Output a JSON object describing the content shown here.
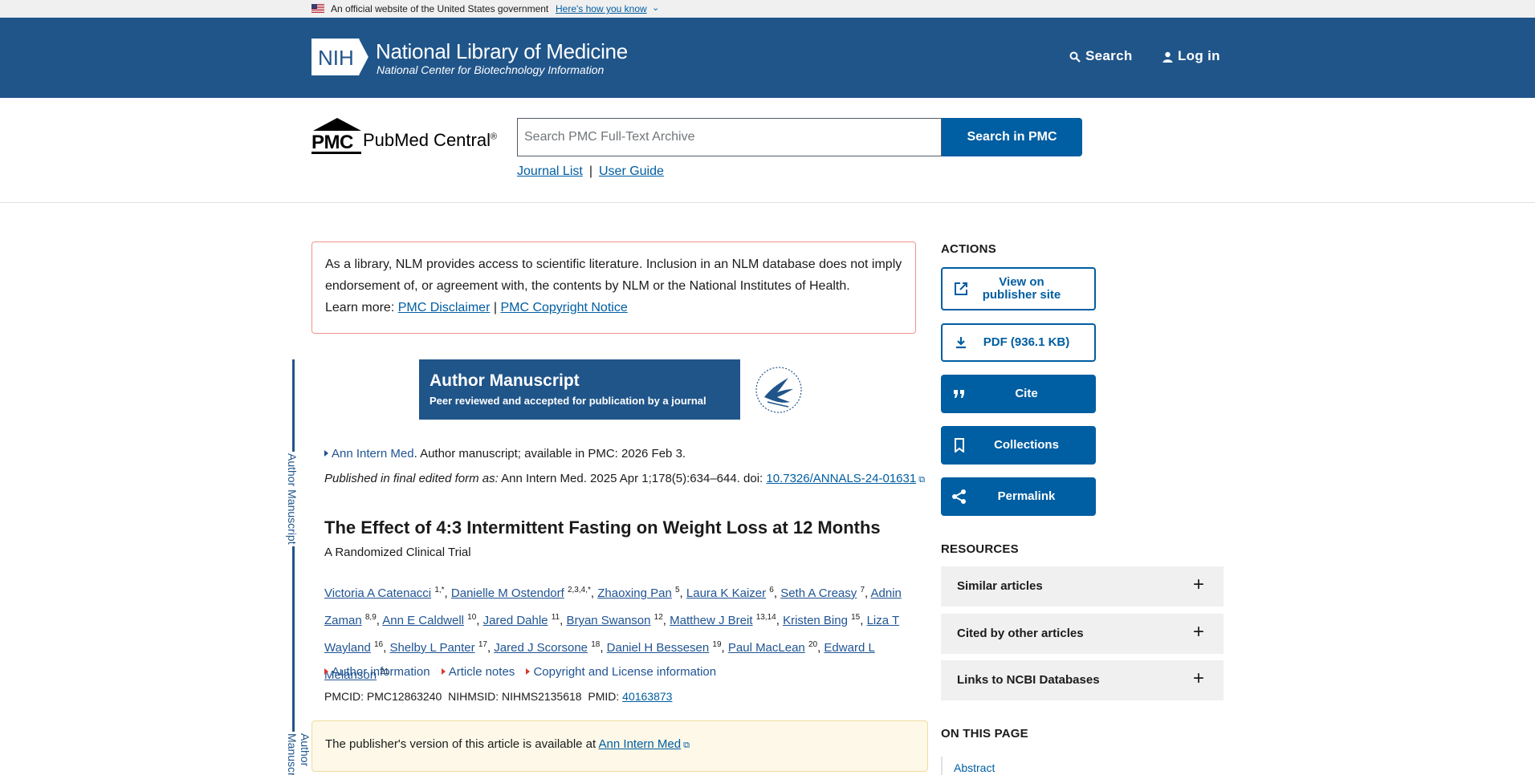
{
  "gov_banner": {
    "official_text": "An official website of the United States government",
    "how_know_link": "Here's how you know"
  },
  "nlm_header": {
    "logo_text": "NIH",
    "title": "National Library of Medicine",
    "subtitle": "National Center for Biotechnology Information",
    "search_label": "Search",
    "login_label": "Log in"
  },
  "pmc": {
    "logo_text": "PMC",
    "name": "PubMed Central",
    "name_mark": "®",
    "search_placeholder": "Search PMC Full-Text Archive",
    "search_button": "Search in PMC",
    "journal_list": "Journal List",
    "user_guide": "User Guide",
    "separator": "|"
  },
  "disclaimer": {
    "text": "As a library, NLM provides access to scientific literature. Inclusion in an NLM database does not imply endorsement of, or agreement with, the contents by NLM or the National Institutes of Health.",
    "learn_more": "Learn more:",
    "link1": "PMC Disclaimer",
    "sep": "|",
    "link2": "PMC Copyright Notice"
  },
  "side_label": "Author Manuscript",
  "manuscript_banner": {
    "title": "Author Manuscript",
    "subtitle": "Peer reviewed and accepted for publication by a journal"
  },
  "article": {
    "journal_link": "Ann Intern Med",
    "journal_rest": ". Author manuscript; available in PMC: 2026 Feb 3.",
    "published_prefix": "Published in final edited form as:",
    "published_citation": "Ann Intern Med. 2025 Apr 1;178(5):634–644. doi:",
    "doi": "10.7326/ANNALS-24-01631",
    "title": "The Effect of 4:3 Intermittent Fasting on Weight Loss at 12 Months",
    "subtitle": "A Randomized Clinical Trial",
    "authors": [
      {
        "name": "Victoria A Catenacci",
        "sup": "1,*"
      },
      {
        "name": "Danielle M Ostendorf",
        "sup": "2,3,4,*"
      },
      {
        "name": "Zhaoxing Pan",
        "sup": "5"
      },
      {
        "name": "Laura K Kaizer",
        "sup": "6"
      },
      {
        "name": "Seth A Creasy",
        "sup": "7"
      },
      {
        "name": "Adnin Zaman",
        "sup": "8,9"
      },
      {
        "name": "Ann E Caldwell",
        "sup": "10"
      },
      {
        "name": "Jared Dahle",
        "sup": "11"
      },
      {
        "name": "Bryan Swanson",
        "sup": "12"
      },
      {
        "name": "Matthew J Breit",
        "sup": "13,14"
      },
      {
        "name": "Kristen Bing",
        "sup": "15"
      },
      {
        "name": "Liza T Wayland",
        "sup": "16"
      },
      {
        "name": "Shelby L Panter",
        "sup": "17"
      },
      {
        "name": "Jared J Scorsone",
        "sup": "18"
      },
      {
        "name": "Daniel H Bessesen",
        "sup": "19"
      },
      {
        "name": "Paul MacLean",
        "sup": "20"
      },
      {
        "name": "Edward L Melanson",
        "sup": "21"
      }
    ],
    "info_links": [
      "Author information",
      "Article notes",
      "Copyright and License information"
    ],
    "pmcid": "PMCID: PMC12863240",
    "nihmsid": "NIHMSID: NIHMS2135618",
    "pmid_label": "PMID:",
    "pmid": "40163873",
    "publisher_text": "The publisher's version of this article is available at",
    "publisher_link": "Ann Intern Med"
  },
  "sidebar": {
    "actions_title": "ACTIONS",
    "view_publisher": "View on publisher site",
    "pdf": "PDF (936.1 KB)",
    "cite": "Cite",
    "collections": "Collections",
    "permalink": "Permalink",
    "resources_title": "RESOURCES",
    "resources": [
      "Similar articles",
      "Cited by other articles",
      "Links to NCBI Databases"
    ],
    "on_this_page_title": "ON THIS PAGE",
    "on_this_page_first": "Abstract"
  },
  "colors": {
    "header_blue": "#20558a",
    "button_blue": "#005ea2",
    "disclaimer_border": "#f2938c",
    "publisher_box_bg": "#fdf8e8"
  }
}
